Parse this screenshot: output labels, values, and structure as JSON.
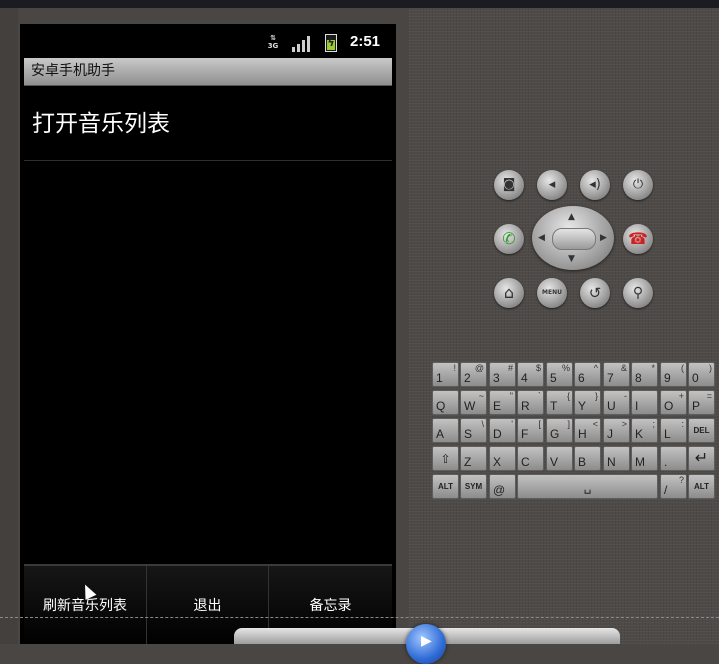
{
  "status_bar": {
    "network": "3G",
    "time": "2:51",
    "icons": [
      "3g-icon",
      "signal-icon",
      "battery-charging-icon"
    ]
  },
  "app": {
    "title": "安卓手机助手",
    "list_items": [
      {
        "label": "打开音乐列表"
      }
    ],
    "menu": [
      {
        "label": "刷新音乐列表"
      },
      {
        "label": "退出"
      },
      {
        "label": "备忘录"
      }
    ]
  },
  "emulator": {
    "hardware_buttons": [
      "camera-icon",
      "volume-down-icon",
      "volume-up-icon",
      "power-icon",
      "call-icon",
      "end-call-icon",
      "home-icon",
      "menu-icon",
      "back-icon",
      "search-icon"
    ],
    "menu_label": "MENU",
    "keyboard": {
      "row1": [
        [
          "1",
          "!"
        ],
        [
          "2",
          "@"
        ],
        [
          "3",
          "#"
        ],
        [
          "4",
          "$"
        ],
        [
          "5",
          "%"
        ],
        [
          "6",
          "^"
        ],
        [
          "7",
          "&"
        ],
        [
          "8",
          "*"
        ],
        [
          "9",
          "("
        ],
        [
          "0",
          ")"
        ]
      ],
      "row2": [
        [
          "Q",
          ""
        ],
        [
          "W",
          "~"
        ],
        [
          "E",
          "\""
        ],
        [
          "R",
          "`"
        ],
        [
          "T",
          "{"
        ],
        [
          "Y",
          "}"
        ],
        [
          "U",
          "-"
        ],
        [
          "I",
          ""
        ],
        [
          "O",
          "+"
        ],
        [
          "P",
          "="
        ]
      ],
      "row3": [
        [
          "A",
          ""
        ],
        [
          "S",
          "\\"
        ],
        [
          "D",
          "'"
        ],
        [
          "F",
          "["
        ],
        [
          "G",
          "]"
        ],
        [
          "H",
          "<"
        ],
        [
          "J",
          ">"
        ],
        [
          "K",
          ";"
        ],
        [
          "L",
          ":"
        ],
        [
          "DEL",
          ""
        ]
      ],
      "row4": [
        [
          "⇧",
          ""
        ],
        [
          "Z",
          ""
        ],
        [
          "X",
          ""
        ],
        [
          "C",
          ""
        ],
        [
          "V",
          ""
        ],
        [
          "B",
          ""
        ],
        [
          "N",
          ""
        ],
        [
          "M",
          ""
        ],
        [
          ".",
          ""
        ],
        [
          "↵",
          ""
        ]
      ],
      "row5": [
        [
          "ALT",
          ""
        ],
        [
          "SYM",
          ""
        ],
        [
          "@",
          ""
        ],
        [
          "␣",
          ""
        ],
        [
          "/",
          "?"
        ],
        [
          ",",
          ""
        ],
        [
          "ALT",
          ""
        ]
      ]
    }
  }
}
